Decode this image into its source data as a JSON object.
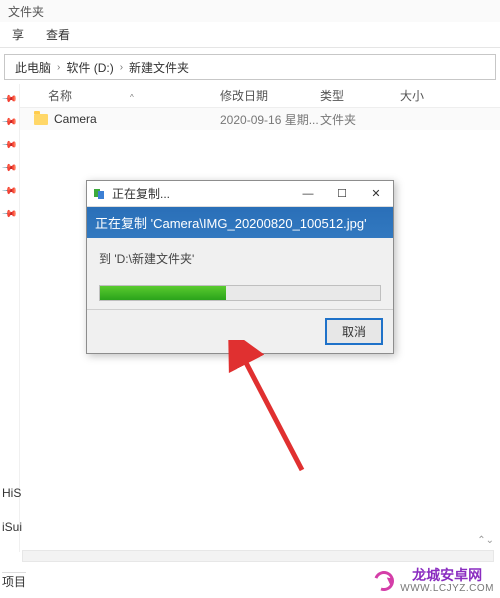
{
  "top_label": "文件夹",
  "menu": {
    "share": "享",
    "view": "查看"
  },
  "breadcrumb": {
    "this_pc": "此电脑",
    "drive": "软件 (D:)",
    "folder": "新建文件夹"
  },
  "columns": {
    "name": "名称",
    "date": "修改日期",
    "type": "类型",
    "size": "大小"
  },
  "rows": [
    {
      "name": "Camera",
      "date": "2020-09-16 星期...",
      "type": "文件夹",
      "size": ""
    }
  ],
  "dialog": {
    "title": "正在复制...",
    "banner": "正在复制 'Camera\\IMG_20200820_100512.jpg'",
    "destination": "到 'D:\\新建文件夹'",
    "progress_pct": 45,
    "cancel": "取消"
  },
  "fragments": {
    "f1": "HiS",
    "f2": "iSui",
    "f3": "项目"
  },
  "watermark": {
    "title": "龙城安卓网",
    "url": "WWW.LCJYZ.COM"
  }
}
